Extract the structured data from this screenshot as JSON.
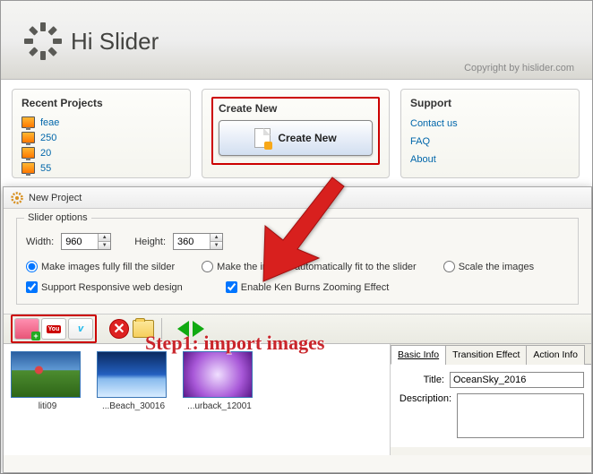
{
  "header": {
    "product": "Hi Slider",
    "copyright": "Copyright by hislider.com"
  },
  "recent": {
    "title": "Recent Projects",
    "items": [
      "feae",
      "250",
      "20",
      "55"
    ]
  },
  "create": {
    "title": "Create New",
    "button": "Create New"
  },
  "support": {
    "title": "Support",
    "links": [
      "Contact us",
      "FAQ",
      "About"
    ]
  },
  "dialog": {
    "title": "New Project",
    "fieldset": "Slider options",
    "width_label": "Width:",
    "width_value": "960",
    "height_label": "Height:",
    "height_value": "360",
    "radio1": "Make images fully fill the silder",
    "radio2": "Make the images automatically fit to the slider",
    "radio3": "Scale the images",
    "check1": "Support Responsive web design",
    "check2": "Enable Ken Burns Zooming Effect"
  },
  "annotation": "Step1: import images",
  "thumbs": [
    {
      "name": "liti09"
    },
    {
      "name": "...Beach_30016"
    },
    {
      "name": "...urback_12001"
    }
  ],
  "info": {
    "tabs": [
      "Basic Info",
      "Transition Effect",
      "Action Info"
    ],
    "title_label": "Title:",
    "title_value": "OceanSky_2016",
    "desc_label": "Description:",
    "desc_value": ""
  }
}
